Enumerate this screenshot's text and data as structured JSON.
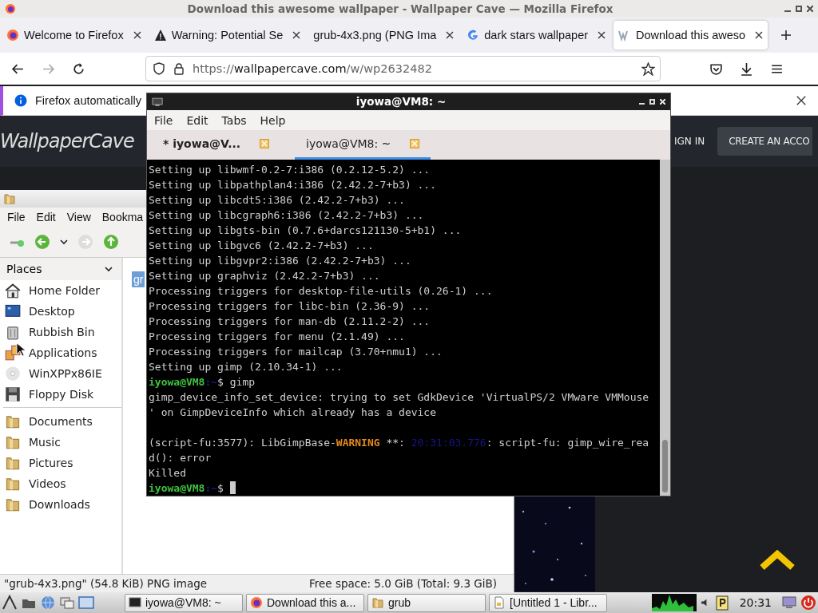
{
  "firefox": {
    "title": "Download this awesome wallpaper - Wallpaper Cave — Mozilla Firefox",
    "tabs": [
      {
        "label": "Welcome to Firefox",
        "kind": "firefox",
        "selected": false
      },
      {
        "label": "Warning: Potential Se",
        "kind": "warning",
        "selected": false
      },
      {
        "label": "grub-4x3.png (PNG Ima",
        "kind": "plain",
        "selected": false
      },
      {
        "label": "dark stars wallpaper",
        "kind": "google",
        "selected": false
      },
      {
        "label": "Download this aweso",
        "kind": "site",
        "selected": true
      }
    ],
    "url": {
      "scheme": "https://",
      "domain": "wallpapercave.com",
      "path": "/w/wp2632482"
    },
    "notification": "Firefox automatically",
    "site": {
      "logo": "WallpaperCave",
      "sign_in": "IGN IN",
      "create_account": "CREATE AN ACCO"
    }
  },
  "file_manager": {
    "menu": [
      "File",
      "Edit",
      "View",
      "Bookma"
    ],
    "places_title": "Places",
    "places": [
      {
        "label": "Home Folder",
        "kind": "home"
      },
      {
        "label": "Desktop",
        "kind": "desktop"
      },
      {
        "label": "Rubbish Bin",
        "kind": "trash"
      },
      {
        "label": "Applications",
        "kind": "apps"
      },
      {
        "label": "WinXPPx86IE",
        "kind": "disc"
      },
      {
        "label": "Floppy Disk",
        "kind": "floppy"
      }
    ],
    "bookmarks": [
      {
        "label": "Documents"
      },
      {
        "label": "Music"
      },
      {
        "label": "Pictures"
      },
      {
        "label": "Videos"
      },
      {
        "label": "Downloads"
      }
    ],
    "files": [
      {
        "label": "gr",
        "selected": true
      }
    ],
    "status": {
      "file": "\"grub-4x3.png\" (54.8 KiB) PNG image",
      "free_space": "Free space: 5.0 GiB (Total: 9.3 GiB)"
    }
  },
  "terminal": {
    "title": "iyowa@VM8: ~",
    "menu": [
      "File",
      "Edit",
      "Tabs",
      "Help"
    ],
    "tabs": [
      {
        "label": "* iyowa@V...",
        "selected": false
      },
      {
        "label": "iyowa@VM8: ~",
        "selected": true
      }
    ],
    "lines": [
      {
        "segments": [
          {
            "text": "Setting up libwmf-0.2-7:i386 (0.2.12-5.2) ...",
            "kind": "plain"
          }
        ]
      },
      {
        "segments": [
          {
            "text": "Setting up libpathplan4:i386 (2.42.2-7+b3) ...",
            "kind": "plain"
          }
        ]
      },
      {
        "segments": [
          {
            "text": "Setting up libcdt5:i386 (2.42.2-7+b3) ...",
            "kind": "plain"
          }
        ]
      },
      {
        "segments": [
          {
            "text": "Setting up libcgraph6:i386 (2.42.2-7+b3) ...",
            "kind": "plain"
          }
        ]
      },
      {
        "segments": [
          {
            "text": "Setting up libgts-bin (0.7.6+darcs121130-5+b1) ...",
            "kind": "plain"
          }
        ]
      },
      {
        "segments": [
          {
            "text": "Setting up libgvc6 (2.42.2-7+b3) ...",
            "kind": "plain"
          }
        ]
      },
      {
        "segments": [
          {
            "text": "Setting up libgvpr2:i386 (2.42.2-7+b3) ...",
            "kind": "plain"
          }
        ]
      },
      {
        "segments": [
          {
            "text": "Setting up graphviz (2.42.2-7+b3) ...",
            "kind": "plain"
          }
        ]
      },
      {
        "segments": [
          {
            "text": "Processing triggers for desktop-file-utils (0.26-1) ...",
            "kind": "plain"
          }
        ]
      },
      {
        "segments": [
          {
            "text": "Processing triggers for libc-bin (2.36-9) ...",
            "kind": "plain"
          }
        ]
      },
      {
        "segments": [
          {
            "text": "Processing triggers for man-db (2.11.2-2) ...",
            "kind": "plain"
          }
        ]
      },
      {
        "segments": [
          {
            "text": "Processing triggers for menu (2.1.49) ...",
            "kind": "plain"
          }
        ]
      },
      {
        "segments": [
          {
            "text": "Processing triggers for mailcap (3.70+nmu1) ...",
            "kind": "plain"
          }
        ]
      },
      {
        "segments": [
          {
            "text": "Setting up gimp (2.10.34-1) ...",
            "kind": "plain"
          }
        ]
      },
      {
        "segments": [
          {
            "text": "iyowa@VM8",
            "kind": "user"
          },
          {
            "text": ":~",
            "kind": "path"
          },
          {
            "text": "$ gimp",
            "kind": "plain"
          }
        ]
      },
      {
        "segments": [
          {
            "text": "gimp_device_info_set_device: trying to set GdkDevice 'VirtualPS/2 VMware VMMouse",
            "kind": "plain"
          }
        ]
      },
      {
        "segments": [
          {
            "text": "' on GimpDeviceInfo which already has a device",
            "kind": "plain"
          }
        ]
      },
      {
        "blank_before": true,
        "segments": [
          {
            "text": "(script-fu:3577): LibGimpBase-",
            "kind": "plain"
          },
          {
            "text": "WARNING",
            "kind": "warning"
          },
          {
            "text": " **: ",
            "kind": "plain"
          },
          {
            "text": "20:31:03.776",
            "kind": "timestamp"
          },
          {
            "text": ": script-fu: gimp_wire_rea",
            "kind": "plain"
          }
        ]
      },
      {
        "segments": [
          {
            "text": "d(): error",
            "kind": "plain"
          }
        ]
      },
      {
        "segments": [
          {
            "text": "Killed",
            "kind": "plain"
          }
        ]
      },
      {
        "cursor": true,
        "segments": [
          {
            "text": "iyowa@VM8",
            "kind": "user"
          },
          {
            "text": ":~",
            "kind": "path"
          },
          {
            "text": "$ ",
            "kind": "plain"
          }
        ]
      }
    ]
  },
  "taskbar": {
    "tasks": [
      {
        "label": "iyowa@VM8: ~",
        "kind": "terminal"
      },
      {
        "label": "Download this a...",
        "kind": "firefox"
      },
      {
        "label": "grub",
        "kind": "folder"
      },
      {
        "label": "[Untitled 1 - Libr...",
        "kind": "document"
      }
    ],
    "clock": "20:31"
  }
}
